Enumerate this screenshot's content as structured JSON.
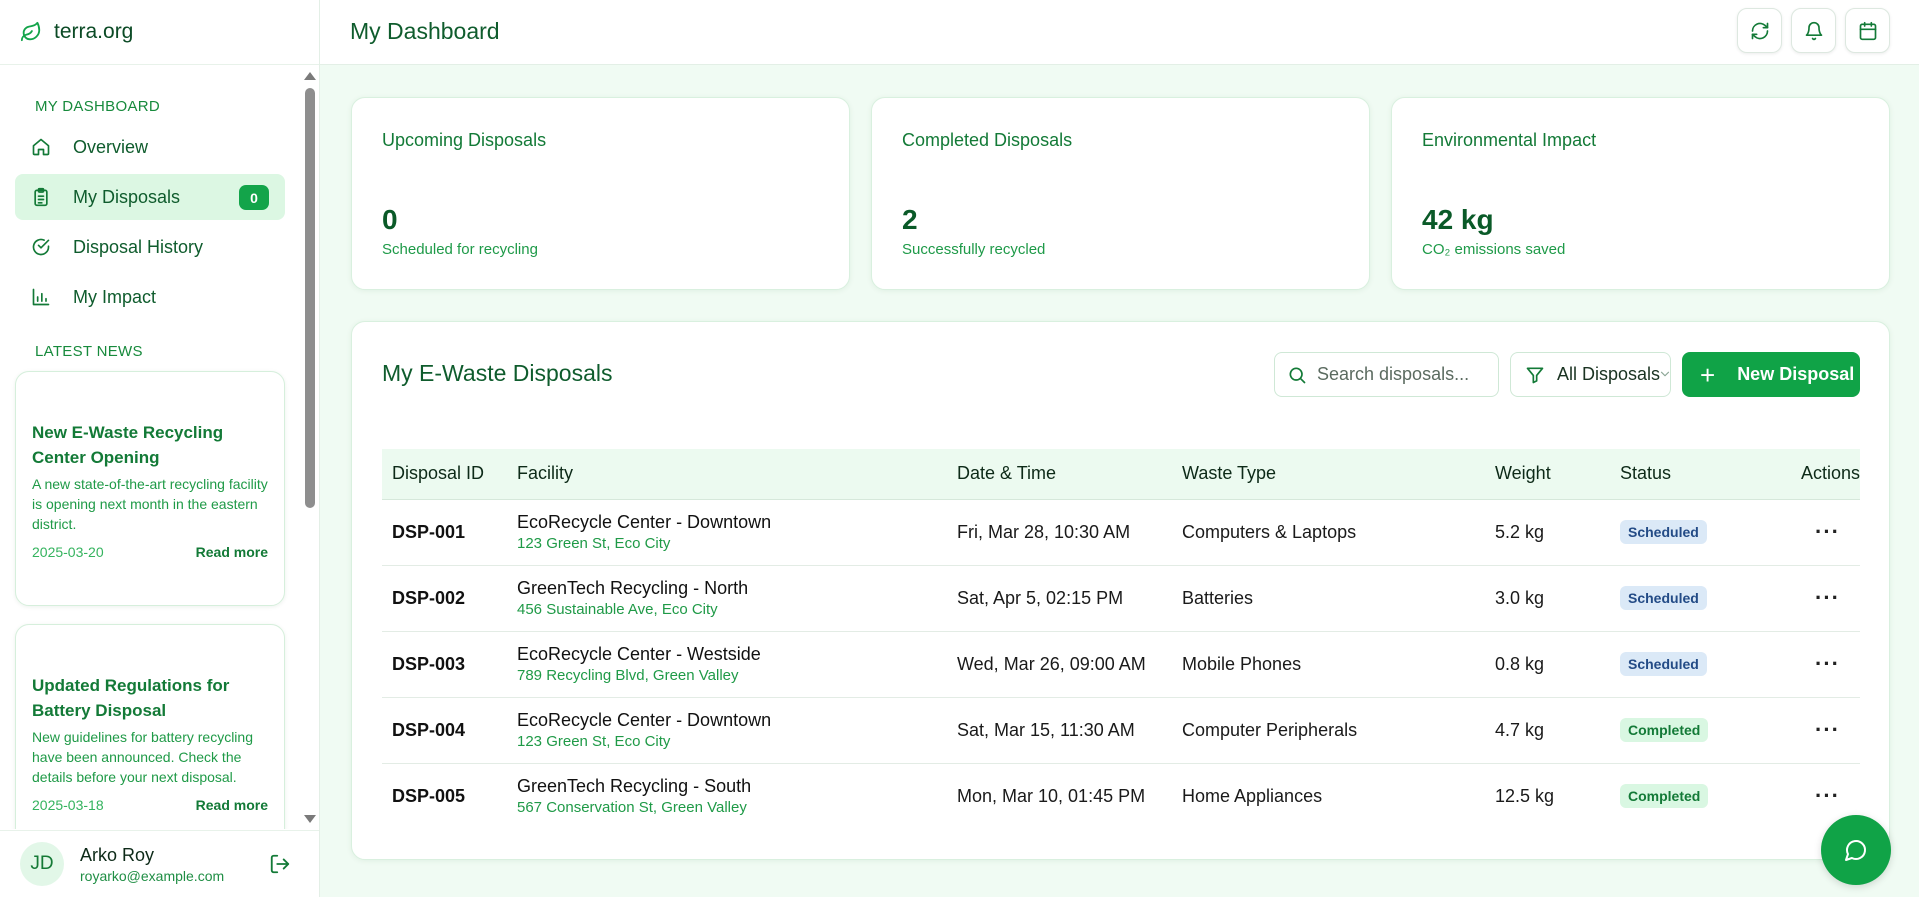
{
  "brand": {
    "name": "terra.org",
    "accent": "#10a347"
  },
  "sidebar": {
    "section_dashboard": "MY DASHBOARD",
    "nav": [
      {
        "label": "Overview",
        "icon": "home-icon"
      },
      {
        "label": "My Disposals",
        "icon": "clipboard-icon",
        "badge": "0",
        "active": true
      },
      {
        "label": "Disposal History",
        "icon": "check-circle-icon"
      },
      {
        "label": "My Impact",
        "icon": "bar-chart-icon"
      }
    ],
    "section_news": "LATEST NEWS",
    "news": [
      {
        "title": "New E-Waste Recycling Center Opening",
        "body": "A new state-of-the-art recycling facility is opening next month in the eastern district.",
        "date": "2025-03-20",
        "link": "Read more"
      },
      {
        "title": "Updated Regulations for Battery Disposal",
        "body": "New guidelines for battery recycling have been announced. Check the details before your next disposal.",
        "date": "2025-03-18",
        "link": "Read more"
      }
    ]
  },
  "user": {
    "initials": "JD",
    "name": "Arko Roy",
    "email": "royarko@example.com"
  },
  "header": {
    "title": "My Dashboard"
  },
  "stats": [
    {
      "title": "Upcoming Disposals",
      "value": "0",
      "sub": "Scheduled for recycling"
    },
    {
      "title": "Completed Disposals",
      "value": "2",
      "sub": "Successfully recycled"
    },
    {
      "title": "Environmental Impact",
      "value": "42 kg",
      "sub": "CO₂ emissions saved"
    }
  ],
  "disposals": {
    "title": "My E-Waste Disposals",
    "search_placeholder": "Search disposals...",
    "filter_label": "All Disposals",
    "new_label": "New Disposal",
    "columns": [
      "Disposal ID",
      "Facility",
      "Date & Time",
      "Waste Type",
      "Weight",
      "Status",
      "Actions"
    ],
    "rows": [
      {
        "id": "DSP-001",
        "facility": "EcoRecycle Center - Downtown",
        "address": "123 Green St, Eco City",
        "datetime": "Fri, Mar 28, 10:30 AM",
        "type": "Computers & Laptops",
        "weight": "5.2 kg",
        "status": "Scheduled",
        "actions": "···"
      },
      {
        "id": "DSP-002",
        "facility": "GreenTech Recycling - North",
        "address": "456 Sustainable Ave, Eco City",
        "datetime": "Sat, Apr 5, 02:15 PM",
        "type": "Batteries",
        "weight": "3.0 kg",
        "status": "Scheduled",
        "actions": "···"
      },
      {
        "id": "DSP-003",
        "facility": "EcoRecycle Center - Westside",
        "address": "789 Recycling Blvd, Green Valley",
        "datetime": "Wed, Mar 26, 09:00 AM",
        "type": "Mobile Phones",
        "weight": "0.8 kg",
        "status": "Scheduled",
        "actions": "···"
      },
      {
        "id": "DSP-004",
        "facility": "EcoRecycle Center - Downtown",
        "address": "123 Green St, Eco City",
        "datetime": "Sat, Mar 15, 11:30 AM",
        "type": "Computer Peripherals",
        "weight": "4.7 kg",
        "status": "Completed",
        "actions": "···"
      },
      {
        "id": "DSP-005",
        "facility": "GreenTech Recycling - South",
        "address": "567 Conservation St, Green Valley",
        "datetime": "Mon, Mar 10, 01:45 PM",
        "type": "Home Appliances",
        "weight": "12.5 kg",
        "status": "Completed",
        "actions": "···"
      }
    ]
  }
}
